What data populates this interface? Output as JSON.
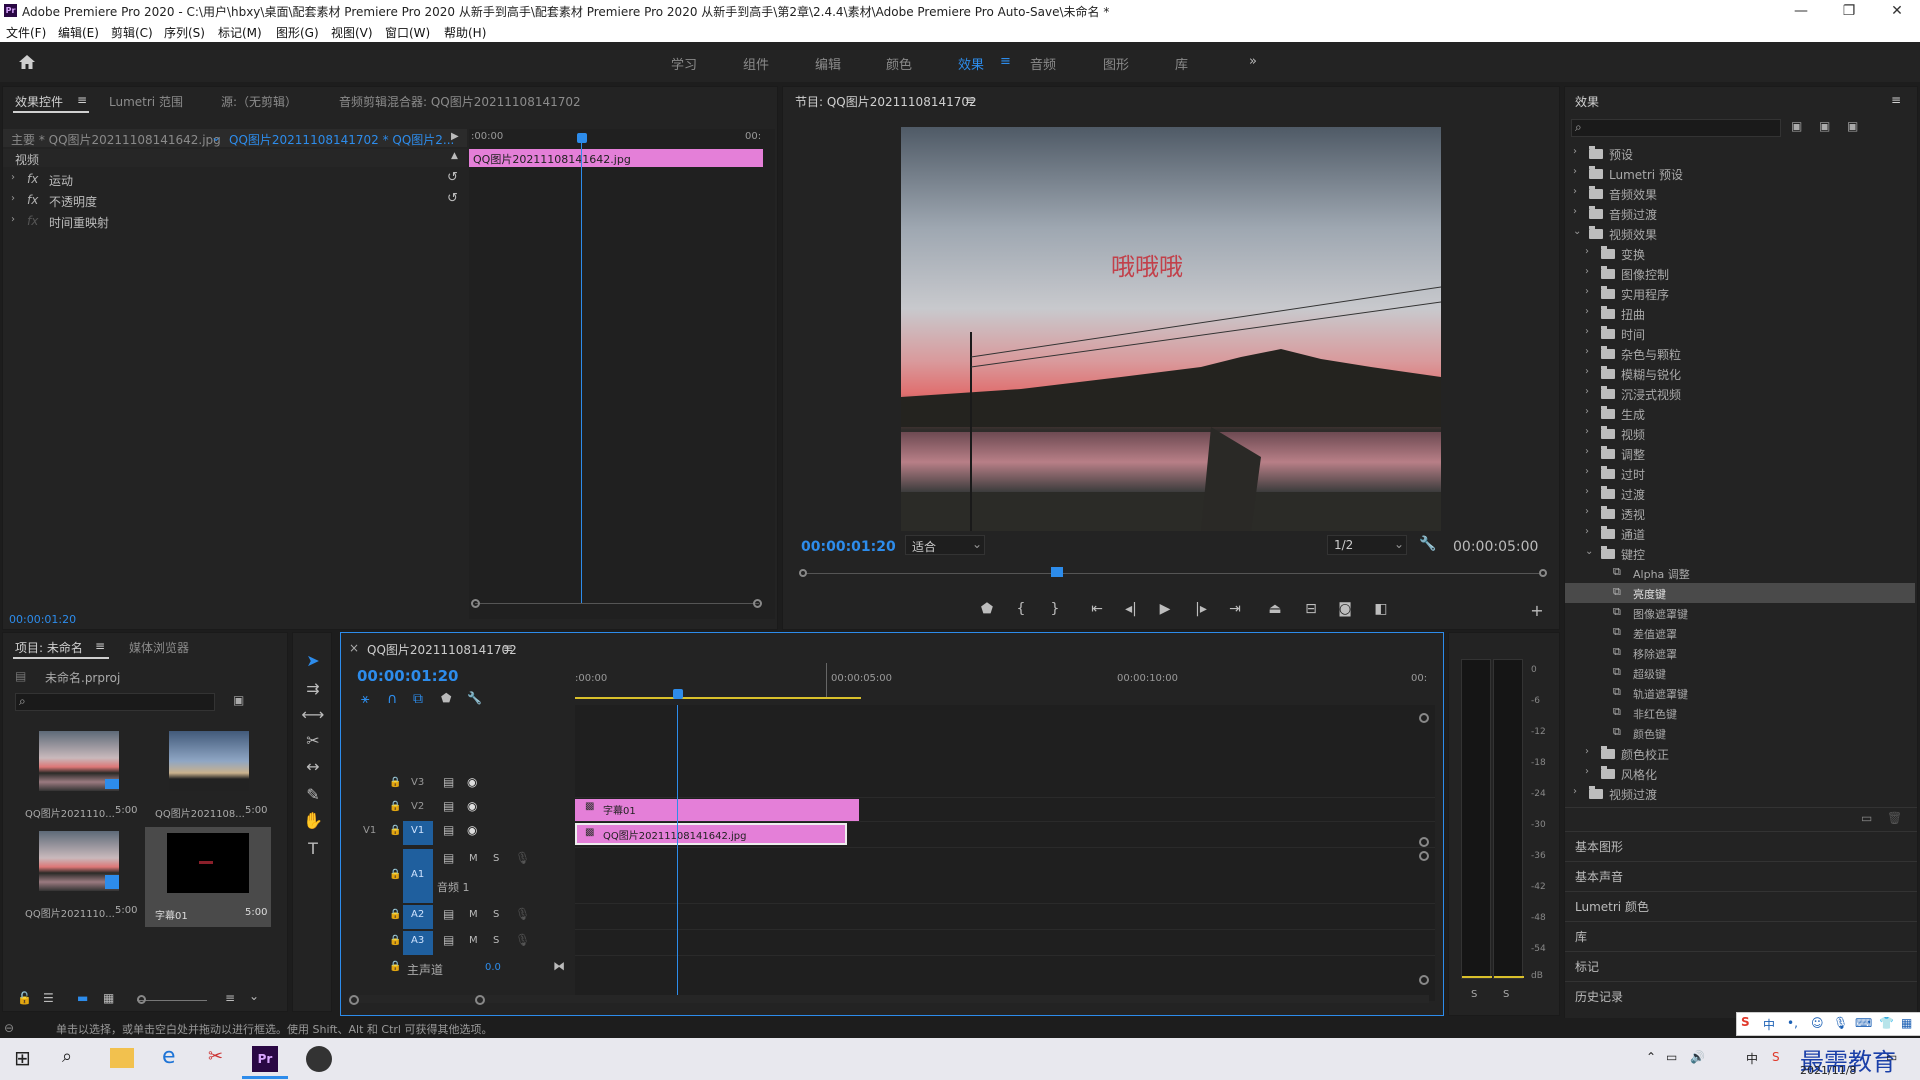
{
  "window": {
    "title": "Adobe Premiere Pro 2020 - C:\\用户\\hbxy\\桌面\\配套素材 Premiere Pro 2020 从新手到高手\\配套素材 Premiere Pro 2020 从新手到高手\\第2章\\2.4.4\\素材\\Adobe Premiere Pro Auto-Save\\未命名 *",
    "app_icon": "Pr",
    "minimize": "—",
    "maximize": "❐",
    "close": "✕"
  },
  "menu": [
    "文件(F)",
    "编辑(E)",
    "剪辑(C)",
    "序列(S)",
    "标记(M)",
    "图形(G)",
    "视图(V)",
    "窗口(W)",
    "帮助(H)"
  ],
  "workspaces": {
    "items": [
      "学习",
      "组件",
      "编辑",
      "颜色",
      "效果",
      "音频",
      "图形",
      "库"
    ],
    "active": "效果",
    "more": "»"
  },
  "effect_controls": {
    "tabs": [
      "效果控件",
      "Lumetri 范围",
      "源:（无剪辑）",
      "音频剪辑混合器: QQ图片20211108141702"
    ],
    "menu_icon": "≡",
    "master": "主要 * QQ图片20211108141642.jpg",
    "sequence": "QQ图片20211108141702 * QQ图片2...",
    "section": "视频",
    "rows": [
      {
        "fx": "fx",
        "label": "运动"
      },
      {
        "fx": "fx",
        "label": "不透明度"
      },
      {
        "fx": "fx",
        "label": "时间重映射"
      }
    ],
    "ruler_start": ":00:00",
    "ruler_end": "00:",
    "clip": "QQ图片20211108141642.jpg",
    "timecode": "00:00:01:20"
  },
  "program": {
    "title": "节目: QQ图片20211108141702",
    "menu_icon": "≡",
    "overlay_text": "哦哦哦",
    "timecode": "00:00:01:20",
    "fit": "适合",
    "resolution": "1/2",
    "duration": "00:00:05:00",
    "colors": {
      "sky_top": "#5a6470",
      "sky_mid": "#b9bfc6",
      "sunset": "#e07a7a",
      "ground": "#2a2a24"
    }
  },
  "effects_panel": {
    "title": "效果",
    "menu_icon": "≡",
    "items": [
      {
        "label": "预设",
        "indent": 0,
        "expanded": false
      },
      {
        "label": "Lumetri 预设",
        "indent": 0,
        "expanded": false
      },
      {
        "label": "音频效果",
        "indent": 0,
        "expanded": false
      },
      {
        "label": "音频过渡",
        "indent": 0,
        "expanded": false
      },
      {
        "label": "视频效果",
        "indent": 0,
        "expanded": true
      },
      {
        "label": "变换",
        "indent": 1,
        "expanded": false
      },
      {
        "label": "图像控制",
        "indent": 1,
        "expanded": false
      },
      {
        "label": "实用程序",
        "indent": 1,
        "expanded": false
      },
      {
        "label": "扭曲",
        "indent": 1,
        "expanded": false
      },
      {
        "label": "时间",
        "indent": 1,
        "expanded": false
      },
      {
        "label": "杂色与颗粒",
        "indent": 1,
        "expanded": false
      },
      {
        "label": "模糊与锐化",
        "indent": 1,
        "expanded": false
      },
      {
        "label": "沉浸式视频",
        "indent": 1,
        "expanded": false
      },
      {
        "label": "生成",
        "indent": 1,
        "expanded": false
      },
      {
        "label": "视频",
        "indent": 1,
        "expanded": false
      },
      {
        "label": "调整",
        "indent": 1,
        "expanded": false
      },
      {
        "label": "过时",
        "indent": 1,
        "expanded": false
      },
      {
        "label": "过渡",
        "indent": 1,
        "expanded": false
      },
      {
        "label": "透视",
        "indent": 1,
        "expanded": false
      },
      {
        "label": "通道",
        "indent": 1,
        "expanded": false
      },
      {
        "label": "键控",
        "indent": 1,
        "expanded": true
      },
      {
        "label": "Alpha 调整",
        "indent": 2,
        "leaf": true
      },
      {
        "label": "亮度键",
        "indent": 2,
        "leaf": true,
        "selected": true
      },
      {
        "label": "图像遮罩键",
        "indent": 2,
        "leaf": true
      },
      {
        "label": "差值遮罩",
        "indent": 2,
        "leaf": true
      },
      {
        "label": "移除遮罩",
        "indent": 2,
        "leaf": true
      },
      {
        "label": "超级键",
        "indent": 2,
        "leaf": true
      },
      {
        "label": "轨道遮罩键",
        "indent": 2,
        "leaf": true
      },
      {
        "label": "非红色键",
        "indent": 2,
        "leaf": true
      },
      {
        "label": "颜色键",
        "indent": 2,
        "leaf": true
      },
      {
        "label": "颜色校正",
        "indent": 1,
        "expanded": false
      },
      {
        "label": "风格化",
        "indent": 1,
        "expanded": false
      },
      {
        "label": "视频过渡",
        "indent": 0,
        "expanded": false
      }
    ],
    "sections": [
      "基本图形",
      "基本声音",
      "Lumetri 颜色",
      "库",
      "标记",
      "历史记录"
    ]
  },
  "project": {
    "tabs": [
      "项目: 未命名",
      "媒体浏览器"
    ],
    "menu_icon": "≡",
    "file": "未命名.prproj",
    "items": [
      {
        "name": "QQ图片2021110...",
        "duration": "5:00"
      },
      {
        "name": "QQ图片2021108...",
        "duration": "5:00"
      },
      {
        "name": "QQ图片2021110...",
        "duration": "5:00"
      },
      {
        "name": "字幕01",
        "duration": "5:00"
      }
    ]
  },
  "timeline": {
    "close": "×",
    "title": "QQ图片20211108141702",
    "menu_icon": "≡",
    "timecode": "00:00:01:20",
    "ruler": [
      ":00:00",
      "00:00:05:00",
      "00:00:10:00",
      "00:"
    ],
    "tracks": [
      {
        "name": "V3"
      },
      {
        "name": "V2"
      },
      {
        "name": "V1",
        "src": "V1"
      },
      {
        "name": "A1",
        "label": "音频 1"
      },
      {
        "name": "A2"
      },
      {
        "name": "A3"
      }
    ],
    "master": "主声道",
    "master_val": "0.0",
    "clips": [
      {
        "track": "V2",
        "name": "字幕01"
      },
      {
        "track": "V1",
        "name": "QQ图片20211108141642.jpg"
      }
    ],
    "track_btns": {
      "mute": "M",
      "solo": "S"
    }
  },
  "meters": {
    "labels": [
      "0",
      "-6",
      "-12",
      "-18",
      "-24",
      "-30",
      "-36",
      "-42",
      "-48",
      "-54",
      "dB"
    ],
    "solo": [
      "S",
      "S"
    ]
  },
  "status": "单击以选择，或单击空白处并拖动以进行框选。使用 Shift、Alt 和 Ctrl 可获得其他选项。",
  "taskbar": {
    "time": "",
    "date": "2021/11/8",
    "watermark": "最需教育",
    "ime": "中"
  }
}
